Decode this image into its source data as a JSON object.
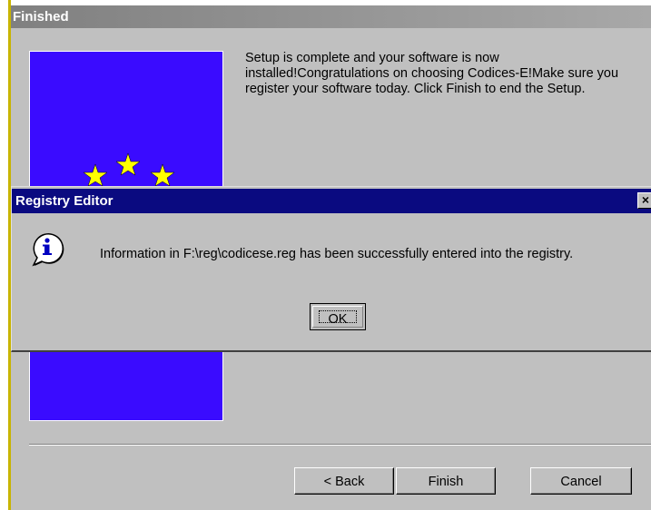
{
  "wizard": {
    "title": "Finished",
    "message": "Setup is complete and your software is now installed!Congratulations on choosing Codices-E!Make sure you register your software today.  Click Finish to end the Setup.",
    "buttons": {
      "back": "< Back",
      "finish": "Finish",
      "cancel": "Cancel"
    },
    "banner_color": "#3a0bff",
    "star_color": "#ffff00"
  },
  "dialog": {
    "title": "Registry Editor",
    "close_label": "×",
    "icon": "information-icon",
    "message": "Information in F:\\reg\\codicese.reg has been successfully entered into the registry.",
    "ok_label": "OK",
    "title_bar_color": "#0a0a80"
  }
}
